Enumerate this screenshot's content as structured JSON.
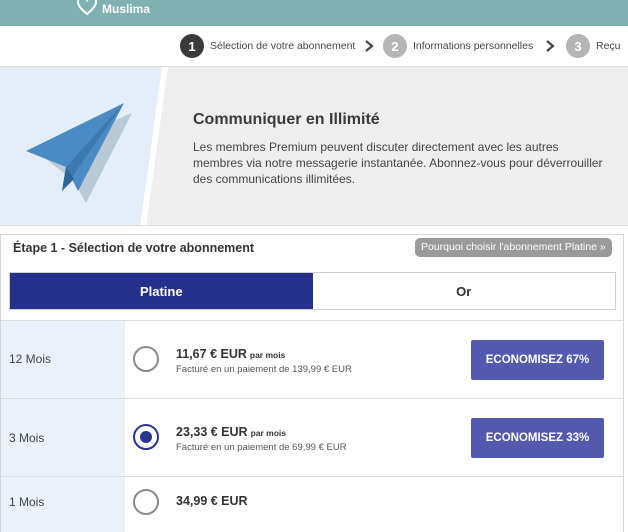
{
  "brand": {
    "name": "Muslima"
  },
  "steps": [
    {
      "num": "1",
      "label": "Sélection de votre abonnement"
    },
    {
      "num": "2",
      "label": "Informations personnelles"
    },
    {
      "num": "3",
      "label": "Reçu"
    }
  ],
  "promo": {
    "title": "Communiquer en Illimité",
    "description": "Les membres Premium peuvent discuter directement avec les autres membres via notre messagerie instantanée. Abonnez-vous pour déverrouiller des communications illimitées."
  },
  "plan": {
    "title": "Étape 1 - Sélection de votre abonnement",
    "why_label": "Pourquoi choisir l'abonnement Platine »",
    "tabs": [
      {
        "label": "Platine",
        "active": true
      },
      {
        "label": "Or",
        "active": false
      }
    ],
    "options": [
      {
        "duration": "12 Mois",
        "price": "11,67 € EUR",
        "unit": "par mois",
        "billing": "Facturé en un paiement de 139,99 € EUR",
        "save": "ECONOMISEZ 67%",
        "selected": false
      },
      {
        "duration": "3 Mois",
        "price": "23,33 € EUR",
        "unit": "par mois",
        "billing": "Facturé en un paiement de 69,99 € EUR",
        "save": "ECONOMISEZ 33%",
        "selected": true
      },
      {
        "duration": "1 Mois",
        "price": "34,99 € EUR",
        "unit": "",
        "billing": "",
        "save": "",
        "selected": false
      }
    ]
  },
  "colors": {
    "header": "#7fb0b2",
    "tab_active": "#25308a",
    "save_button": "#5459b0",
    "row_left": "#eaf1fa",
    "plane": "#4a8bc4"
  },
  "icons": [
    "heart-logo-icon",
    "chevron-right-icon",
    "paper-plane-icon"
  ]
}
